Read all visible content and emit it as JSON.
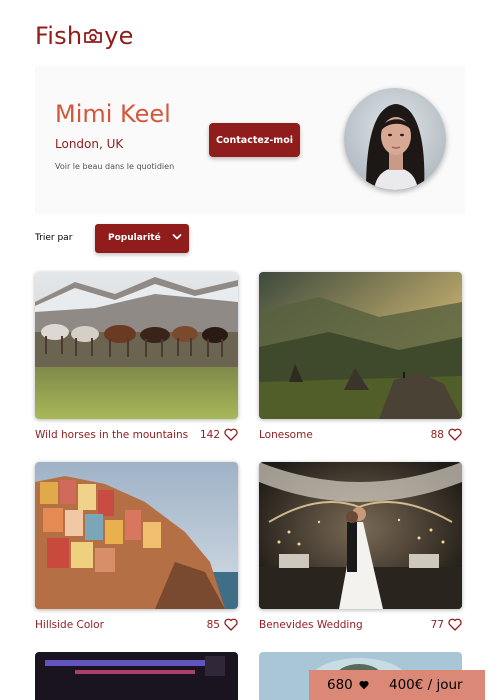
{
  "brand": {
    "logo_left": "Fish",
    "logo_right": "ye"
  },
  "photographer": {
    "name": "Mimi Keel",
    "location": "London, UK",
    "tagline": "Voir le beau dans le quotidien",
    "contact_label": "Contactez-moi"
  },
  "sort": {
    "label": "Trier par",
    "selected": "Popularité"
  },
  "gallery": [
    {
      "title": "Wild horses in the mountains",
      "likes": "142"
    },
    {
      "title": "Lonesome",
      "likes": "88"
    },
    {
      "title": "Hillside Color",
      "likes": "85"
    },
    {
      "title": "Benevides Wedding",
      "likes": "77"
    }
  ],
  "info": {
    "total_likes": "680",
    "price": "400€ / jour"
  },
  "colors": {
    "primary": "#901c1c",
    "secondary": "#d3573c",
    "info_bg": "#db8876",
    "header_bg": "#fafafa"
  },
  "icons": [
    "camera-icon",
    "heart-icon",
    "chevron-down-icon"
  ]
}
